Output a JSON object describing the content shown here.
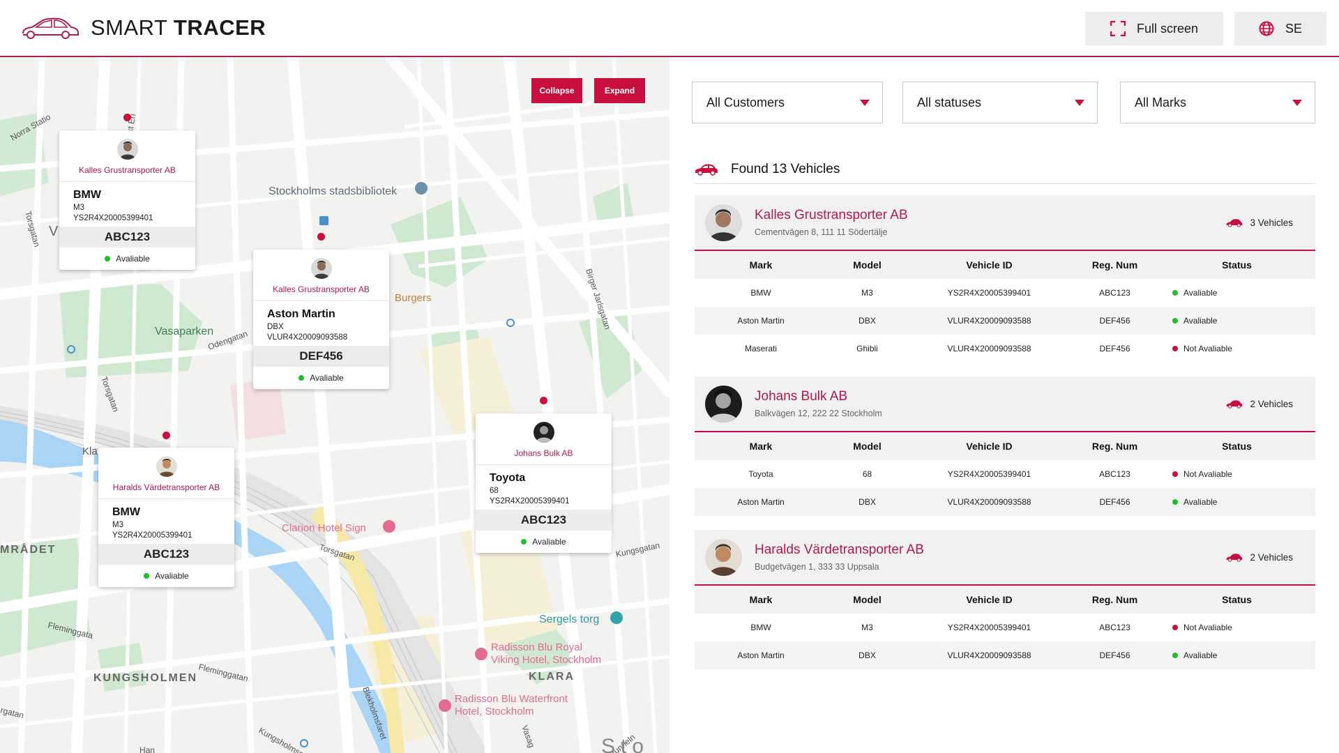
{
  "header": {
    "logo_light": "SMART ",
    "logo_bold": "TRACER",
    "fullscreen_label": "Full screen",
    "lang_label": "SE"
  },
  "map": {
    "collapse_label": "Collapse",
    "expand_label": "Expand",
    "labels": {
      "stadsbibliotek": "Stockholms stadsbibliotek",
      "vasaparken": "Vasaparken",
      "burgers": "Burgers",
      "clarion": "Clarion Hotel Sign",
      "sergels": "Sergels torg",
      "radisson1a": "Radisson Blu Royal",
      "radisson1b": "Viking Hotel, Stockholm",
      "radisson2a": "Radisson Blu Waterfront",
      "radisson2b": "Hotel, Stockholm",
      "kungsholmen": "KUNGSHOLMEN",
      "klara": "KLARA",
      "omradet": "MRÅDET",
      "norra": "Norra Statio",
      "sankt": "Sankt Eri",
      "torsgatan1": "Torsgatan",
      "torsgatan2": "Torsgatan",
      "torsgatan3": "Torsgatan",
      "odengatan": "Odengatan",
      "birger": "Birger Jarlsgatan",
      "kungsgatan": "Kungsgatan",
      "fleminggatan1": "Fleminggata",
      "fleminggatan2": "Fleminggatan",
      "kungsholmsgatan": "Kungsholmsgatan",
      "bleckholms": "Blekholmsfaret",
      "klaratunneln": "Klaratunneln",
      "vasag": "Vasag",
      "kla": "Kla",
      "v": "V",
      "rgatan": "rgatan",
      "han": "Han",
      "sto": "Sto"
    },
    "cards": [
      {
        "company": "Kalles Grustransporter AB",
        "mark": "BMW",
        "model": "M3",
        "vid": "YS2R4X20005399401",
        "reg": "ABC123",
        "status": "Avaliable",
        "status_color": "#1fbf2a"
      },
      {
        "company": "Kalles Grustransporter AB",
        "mark": "Aston Martin",
        "model": "DBX",
        "vid": "VLUR4X20009093588",
        "reg": "DEF456",
        "status": "Avaliable",
        "status_color": "#1fbf2a"
      },
      {
        "company": "Haralds Värdetransporter AB",
        "mark": "BMW",
        "model": "M3",
        "vid": "YS2R4X20005399401",
        "reg": "ABC123",
        "status": "Avaliable",
        "status_color": "#1fbf2a"
      },
      {
        "company": "Johans Bulk AB",
        "mark": "Toyota",
        "model": "68",
        "vid": "YS2R4X20005399401",
        "reg": "ABC123",
        "status": "Avaliable",
        "status_color": "#1fbf2a"
      }
    ]
  },
  "filters": {
    "customers": "All Customers",
    "statuses": "All statuses",
    "marks": "All Marks"
  },
  "found_label": "Found 13 Vehicles",
  "columns": [
    "Mark",
    "Model",
    "Vehicle ID",
    "Reg. Num",
    "Status"
  ],
  "customers": [
    {
      "name": "Kalles Grustransporter AB",
      "address": "Cementvägen 8, 111 11 Södertälje",
      "count": "3 Vehicles",
      "rows": [
        {
          "mark": "BMW",
          "model": "M3",
          "vid": "YS2R4X20005399401",
          "reg": "ABC123",
          "status": "Avaliable",
          "ok": true
        },
        {
          "mark": "Aston Martin",
          "model": "DBX",
          "vid": "VLUR4X20009093588",
          "reg": "DEF456",
          "status": "Avaliable",
          "ok": true
        },
        {
          "mark": "Maserati",
          "model": "Ghibli",
          "vid": "VLUR4X20009093588",
          "reg": "DEF456",
          "status": "Not Avaliable",
          "ok": false
        }
      ]
    },
    {
      "name": "Johans Bulk AB",
      "address": "Balkvägen 12, 222 22 Stockholm",
      "count": "2 Vehicles",
      "rows": [
        {
          "mark": "Toyota",
          "model": "68",
          "vid": "YS2R4X20005399401",
          "reg": "ABC123",
          "status": "Not Avaliable",
          "ok": false
        },
        {
          "mark": "Aston Martin",
          "model": "DBX",
          "vid": "VLUR4X20009093588",
          "reg": "DEF456",
          "status": "Avaliable",
          "ok": true
        }
      ]
    },
    {
      "name": "Haralds Värdetransporter AB",
      "address": "Budgetvägen 1, 333 33 Uppsala",
      "count": "2 Vehicles",
      "rows": [
        {
          "mark": "BMW",
          "model": "M3",
          "vid": "YS2R4X20005399401",
          "reg": "ABC123",
          "status": "Not Avaliable",
          "ok": false
        },
        {
          "mark": "Aston Martin",
          "model": "DBX",
          "vid": "VLUR4X20009093588",
          "reg": "DEF456",
          "status": "Avaliable",
          "ok": true
        }
      ]
    }
  ],
  "colors": {
    "accent": "#c8103f",
    "company_text": "#b01a48",
    "available": "#1fbf2a",
    "not_available": "#c8103f"
  }
}
